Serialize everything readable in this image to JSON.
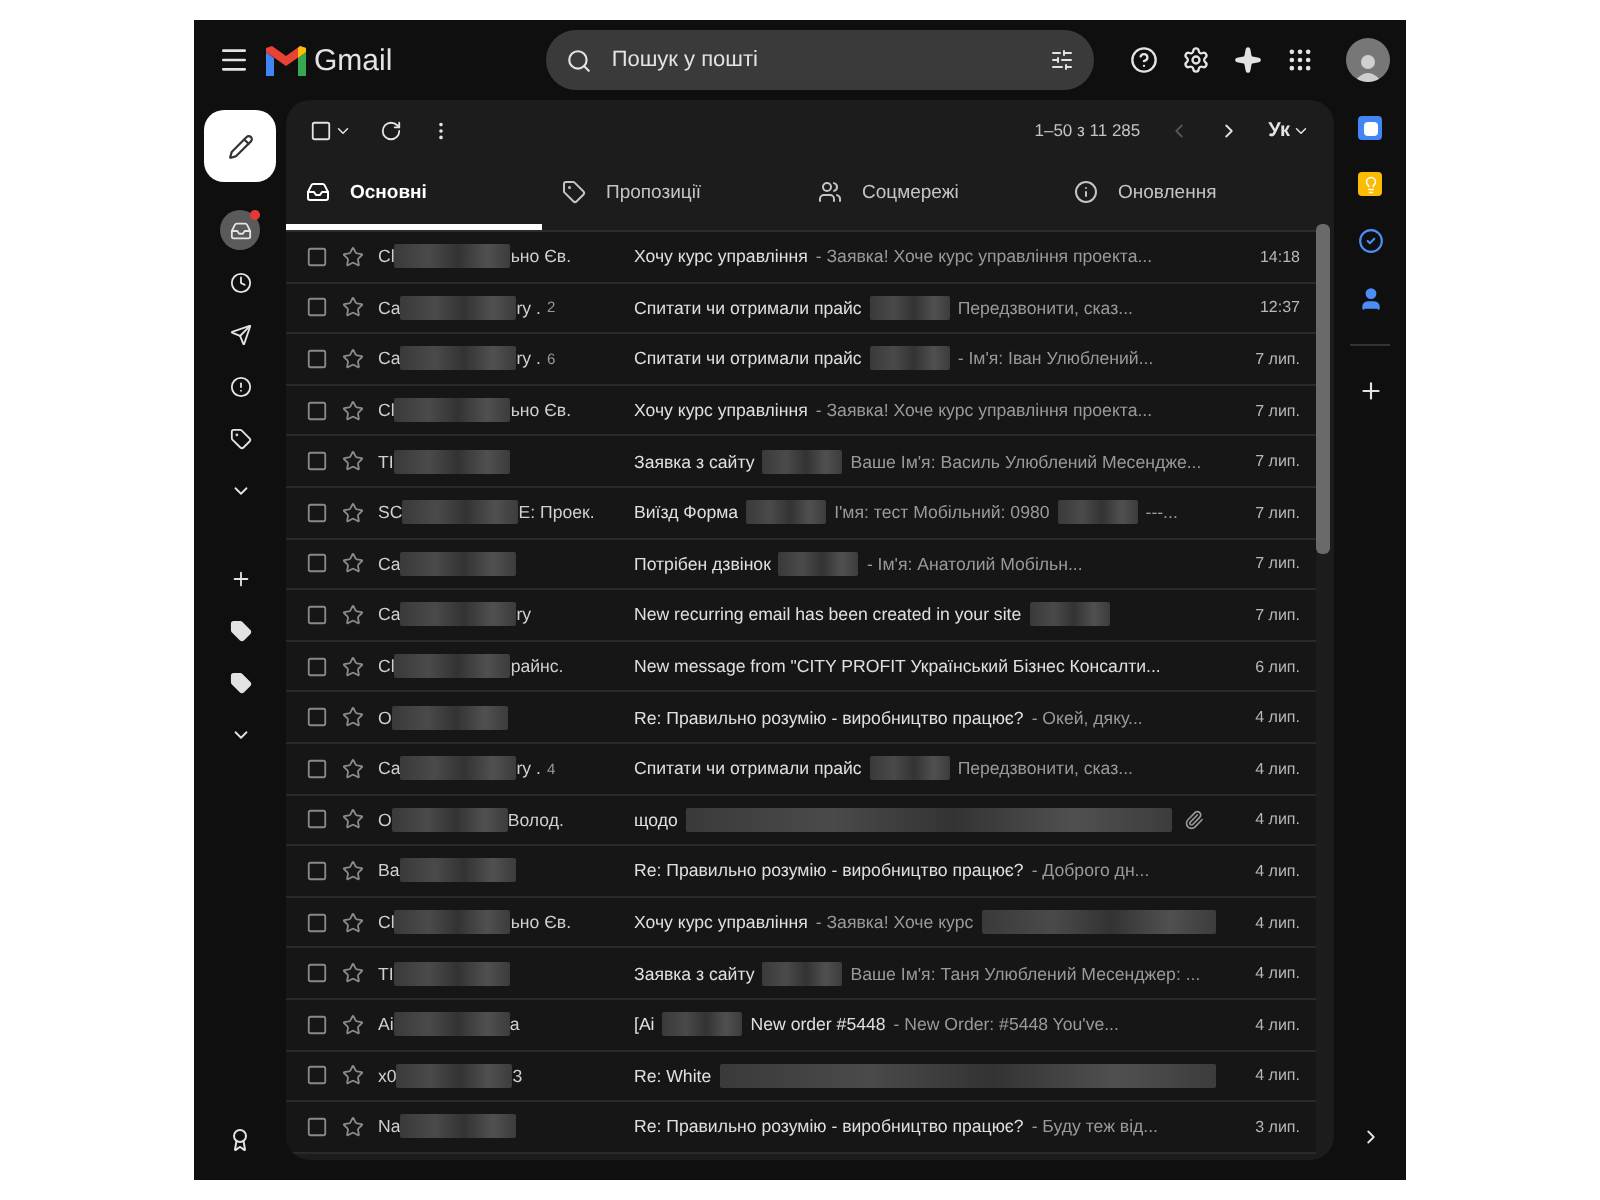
{
  "app": {
    "name": "Gmail"
  },
  "search": {
    "placeholder": "Пошук у пошті"
  },
  "toolbar": {
    "select_all_checked": false,
    "range": "1–50 з 11 285",
    "input_tool": "Ук"
  },
  "sidebar": {
    "items": [
      {
        "kind": "inbox",
        "selected": true,
        "badge": true
      },
      {
        "kind": "clock",
        "selected": false,
        "badge": false
      },
      {
        "kind": "send",
        "selected": false,
        "badge": false
      },
      {
        "kind": "alert",
        "selected": false,
        "badge": false
      },
      {
        "kind": "label",
        "selected": false,
        "badge": false
      },
      {
        "kind": "more",
        "selected": false,
        "badge": false
      },
      {
        "kind": "add",
        "selected": false,
        "badge": false
      },
      {
        "kind": "label_filled",
        "selected": false,
        "badge": false
      },
      {
        "kind": "label_filled",
        "selected": false,
        "badge": false
      },
      {
        "kind": "more",
        "selected": false,
        "badge": false
      }
    ]
  },
  "tabs": [
    {
      "label": "Основні",
      "kind": "inbox",
      "selected": true
    },
    {
      "label": "Пропозиції",
      "kind": "tag",
      "selected": false
    },
    {
      "label": "Соцмережі",
      "kind": "people",
      "selected": false
    },
    {
      "label": "Оновлення",
      "kind": "info",
      "selected": false
    }
  ],
  "emails": [
    {
      "checked": false,
      "sender": [
        {
          "kind": "text",
          "text": "Cl"
        },
        {
          "kind": "blur"
        },
        {
          "kind": "text",
          "text": "ьно Єв."
        }
      ],
      "subject": [
        {
          "kind": "subject",
          "text": "Хочу курс управління"
        },
        {
          "kind": "snippet",
          "text": "- Заявка! Хоче курс управління проекта..."
        }
      ],
      "attachment": false,
      "date": "14:18"
    },
    {
      "checked": false,
      "sender": [
        {
          "kind": "text",
          "text": "Ca"
        },
        {
          "kind": "blur"
        },
        {
          "kind": "text",
          "text": "ry ."
        }
      ],
      "count": "2",
      "subject": [
        {
          "kind": "subject",
          "text": "Спитати чи отримали прайс"
        },
        {
          "kind": "blur"
        },
        {
          "kind": "snippet",
          "text": "Передзвонити, сказ..."
        }
      ],
      "attachment": false,
      "date": "12:37"
    },
    {
      "checked": false,
      "sender": [
        {
          "kind": "text",
          "text": "Ca"
        },
        {
          "kind": "blur"
        },
        {
          "kind": "text",
          "text": "ry ."
        }
      ],
      "count": "6",
      "subject": [
        {
          "kind": "subject",
          "text": "Спитати чи отримали прайс"
        },
        {
          "kind": "blur"
        },
        {
          "kind": "snippet",
          "text": "- Ім'я: Іван Улюблений..."
        }
      ],
      "attachment": false,
      "date": "7 лип."
    },
    {
      "checked": false,
      "sender": [
        {
          "kind": "text",
          "text": "Cl"
        },
        {
          "kind": "blur"
        },
        {
          "kind": "text",
          "text": "ьно Єв."
        }
      ],
      "subject": [
        {
          "kind": "subject",
          "text": "Хочу курс управління"
        },
        {
          "kind": "snippet",
          "text": "- Заявка! Хоче курс управління проекта..."
        }
      ],
      "attachment": false,
      "date": "7 лип."
    },
    {
      "checked": false,
      "sender": [
        {
          "kind": "text",
          "text": "TI"
        },
        {
          "kind": "blur"
        }
      ],
      "subject": [
        {
          "kind": "subject",
          "text": "Заявка з сайту"
        },
        {
          "kind": "blur"
        },
        {
          "kind": "snippet",
          "text": "Ваше Ім'я: Василь Улюблений Месендже..."
        }
      ],
      "attachment": false,
      "date": "7 лип."
    },
    {
      "checked": false,
      "sender": [
        {
          "kind": "text",
          "text": "SC"
        },
        {
          "kind": "blur"
        },
        {
          "kind": "text",
          "text": "Е: Проек."
        }
      ],
      "subject": [
        {
          "kind": "subject",
          "text": "Виїзд Форма"
        },
        {
          "kind": "blur"
        },
        {
          "kind": "snippet",
          "text": "І'мя: тест Мобільний: 0980"
        },
        {
          "kind": "blur"
        },
        {
          "kind": "snippet",
          "text": "---..."
        }
      ],
      "attachment": false,
      "date": "7 лип."
    },
    {
      "checked": false,
      "sender": [
        {
          "kind": "text",
          "text": "Ca"
        },
        {
          "kind": "blur"
        }
      ],
      "subject": [
        {
          "kind": "subject",
          "text": "Потрібен дзвінок"
        },
        {
          "kind": "blur"
        },
        {
          "kind": "snippet",
          "text": "- Ім'я: Анатолий Мобільн..."
        }
      ],
      "attachment": false,
      "date": "7 лип."
    },
    {
      "checked": false,
      "sender": [
        {
          "kind": "text",
          "text": "Ca"
        },
        {
          "kind": "blur"
        },
        {
          "kind": "text",
          "text": "ry"
        }
      ],
      "subject": [
        {
          "kind": "subject",
          "text": "New recurring email has been created in your site"
        },
        {
          "kind": "blur"
        }
      ],
      "attachment": false,
      "date": "7 лип."
    },
    {
      "checked": false,
      "sender": [
        {
          "kind": "text",
          "text": "Cl"
        },
        {
          "kind": "blur"
        },
        {
          "kind": "text",
          "text": "райнс."
        }
      ],
      "subject": [
        {
          "kind": "subject",
          "text": "New message from \"CITY PROFIT Український Бізнес Консалти..."
        }
      ],
      "attachment": false,
      "date": "6 лип."
    },
    {
      "checked": false,
      "sender": [
        {
          "kind": "text",
          "text": "O"
        },
        {
          "kind": "blur"
        }
      ],
      "subject": [
        {
          "kind": "subject",
          "text": "Re: Правильно розумію - виробництво працює?"
        },
        {
          "kind": "snippet",
          "text": "- Окей, дяку..."
        }
      ],
      "attachment": false,
      "date": "4 лип."
    },
    {
      "checked": false,
      "sender": [
        {
          "kind": "text",
          "text": "Ca"
        },
        {
          "kind": "blur"
        },
        {
          "kind": "text",
          "text": "ry ."
        }
      ],
      "count": "4",
      "subject": [
        {
          "kind": "subject",
          "text": "Спитати чи отримали прайс"
        },
        {
          "kind": "blur"
        },
        {
          "kind": "snippet",
          "text": "Передзвонити, сказ..."
        }
      ],
      "attachment": false,
      "date": "4 лип."
    },
    {
      "checked": false,
      "sender": [
        {
          "kind": "text",
          "text": "O"
        },
        {
          "kind": "blur"
        },
        {
          "kind": "text",
          "text": "Волод."
        }
      ],
      "subject": [
        {
          "kind": "subject",
          "text": "щодо"
        },
        {
          "kind": "blur_long"
        }
      ],
      "attachment": true,
      "date": "4 лип."
    },
    {
      "checked": false,
      "sender": [
        {
          "kind": "text",
          "text": "Ba"
        },
        {
          "kind": "blur"
        }
      ],
      "subject": [
        {
          "kind": "subject",
          "text": "Re: Правильно розумію - виробництво працює?"
        },
        {
          "kind": "snippet",
          "text": "- Доброго дн..."
        }
      ],
      "attachment": false,
      "date": "4 лип."
    },
    {
      "checked": false,
      "sender": [
        {
          "kind": "text",
          "text": "Cl"
        },
        {
          "kind": "blur"
        },
        {
          "kind": "text",
          "text": "ьно Єв."
        }
      ],
      "subject": [
        {
          "kind": "subject",
          "text": "Хочу курс управління"
        },
        {
          "kind": "snippet",
          "text": "- Заявка! Хоче курс"
        },
        {
          "kind": "blur_long"
        }
      ],
      "attachment": false,
      "date": "4 лип."
    },
    {
      "checked": false,
      "sender": [
        {
          "kind": "text",
          "text": "TI"
        },
        {
          "kind": "blur"
        }
      ],
      "subject": [
        {
          "kind": "subject",
          "text": "Заявка з сайту"
        },
        {
          "kind": "blur"
        },
        {
          "kind": "snippet",
          "text": "Ваше Ім'я: Таня Улюблений Месенджер: ..."
        }
      ],
      "attachment": false,
      "date": "4 лип."
    },
    {
      "checked": false,
      "sender": [
        {
          "kind": "text",
          "text": "Ai"
        },
        {
          "kind": "blur"
        },
        {
          "kind": "text",
          "text": "a"
        }
      ],
      "subject": [
        {
          "kind": "subject",
          "text": "[Ai"
        },
        {
          "kind": "blur"
        },
        {
          "kind": "subject",
          "text": "New order #5448"
        },
        {
          "kind": "snippet",
          "text": "- New Order: #5448 You've..."
        }
      ],
      "attachment": false,
      "date": "4 лип."
    },
    {
      "checked": false,
      "sender": [
        {
          "kind": "text",
          "text": "x0"
        },
        {
          "kind": "blur"
        },
        {
          "kind": "text",
          "text": "3"
        }
      ],
      "subject": [
        {
          "kind": "subject",
          "text": "Re: White"
        },
        {
          "kind": "blur_long"
        }
      ],
      "attachment": false,
      "date": "4 лип."
    },
    {
      "checked": false,
      "sender": [
        {
          "kind": "text",
          "text": "Na"
        },
        {
          "kind": "blur"
        }
      ],
      "subject": [
        {
          "kind": "subject",
          "text": "Re: Правильно розумію - виробництво працює?"
        },
        {
          "kind": "snippet",
          "text": "- Буду теж від..."
        }
      ],
      "attachment": false,
      "date": "3 лип."
    }
  ]
}
